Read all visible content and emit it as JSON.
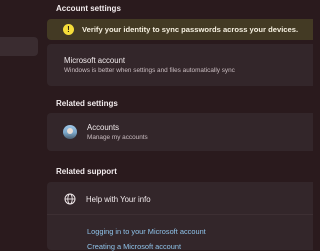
{
  "account_settings": {
    "title": "Account settings",
    "banner_text": "Verify your identity to sync passwords across your devices.",
    "banner_icon": "warning-icon",
    "microsoft_account": {
      "title": "Microsoft account",
      "subtitle": "Windows is better when settings and files automatically sync"
    }
  },
  "related_settings": {
    "title": "Related settings",
    "accounts": {
      "title": "Accounts",
      "subtitle": "Manage my accounts"
    }
  },
  "related_support": {
    "title": "Related support",
    "help": {
      "title": "Help with Your info",
      "icon": "globe-icon"
    },
    "links": [
      "Logging in to your Microsoft account",
      "Creating a Microsoft account"
    ]
  },
  "colors": {
    "background": "#2a1a1d",
    "card": "#33262a",
    "banner": "#433a24",
    "warning": "#f5dd3a",
    "link": "#8fc3ea"
  }
}
